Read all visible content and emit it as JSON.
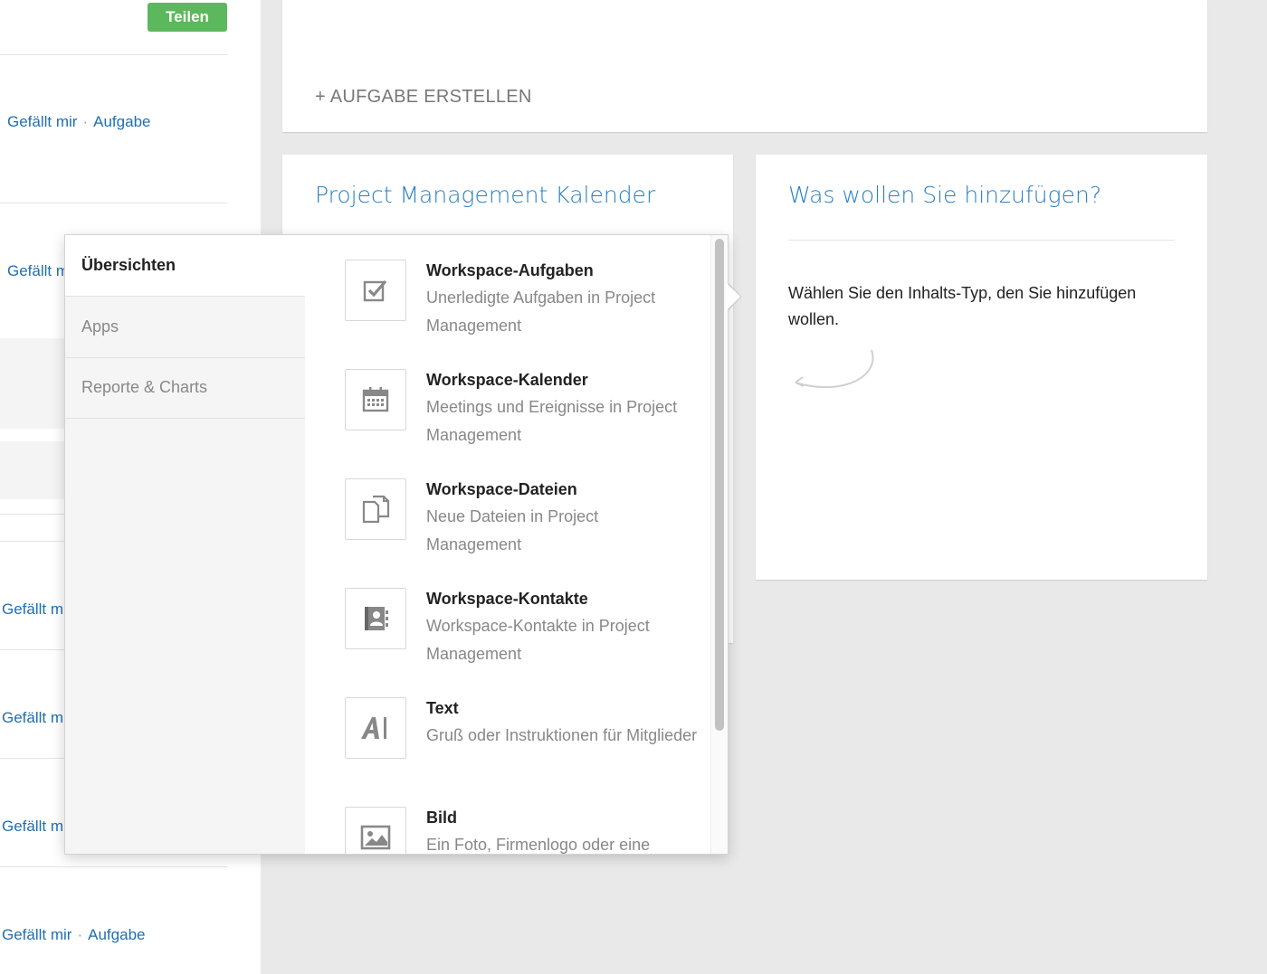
{
  "feed": {
    "share_label": "Teilen",
    "links": [
      {
        "like": "Gefällt mir",
        "sep": "·",
        "task": "Aufgabe"
      },
      {
        "like": "Gefällt m"
      },
      {
        "like": "Gefällt m"
      },
      {
        "like": "Gefällt m"
      },
      {
        "like": "Gefällt m"
      },
      {
        "like": "Gefällt mir",
        "sep": "·",
        "task": "Aufgabe"
      }
    ]
  },
  "task_card": {
    "create_label": "+ AUFGABE ERSTELLEN"
  },
  "calendar_card": {
    "title": "Project Management Kalender"
  },
  "add_card": {
    "title": "Was wollen Sie hinzufügen?",
    "hint": "Wählen Sie den Inhalts-Typ, den Sie hinzufügen wollen."
  },
  "popover": {
    "tabs": [
      {
        "label": "Übersichten",
        "active": true
      },
      {
        "label": "Apps"
      },
      {
        "label": "Reporte & Charts"
      }
    ],
    "items": [
      {
        "title": "Workspace-Aufgaben",
        "desc": "Unerledigte Aufgaben in Project Management",
        "icon": "checkbox-icon"
      },
      {
        "title": "Workspace-Kalender",
        "desc": "Meetings und Ereignisse in Project Management",
        "icon": "calendar-icon"
      },
      {
        "title": "Workspace-Dateien",
        "desc": "Neue Dateien in Project Management",
        "icon": "files-icon"
      },
      {
        "title": "Workspace-Kontakte",
        "desc": "Workspace-Kontakte in Project Management",
        "icon": "contacts-icon"
      },
      {
        "title": "Text",
        "desc": "Gruß oder Instruktionen für Mitglieder",
        "icon": "text-icon"
      },
      {
        "title": "Bild",
        "desc": "Ein Foto, Firmenlogo oder eine",
        "icon": "image-icon"
      }
    ]
  },
  "colors": {
    "accent_blue": "#2a80c4",
    "link_blue": "#1f6fb2",
    "share_green": "#5cb85c"
  }
}
